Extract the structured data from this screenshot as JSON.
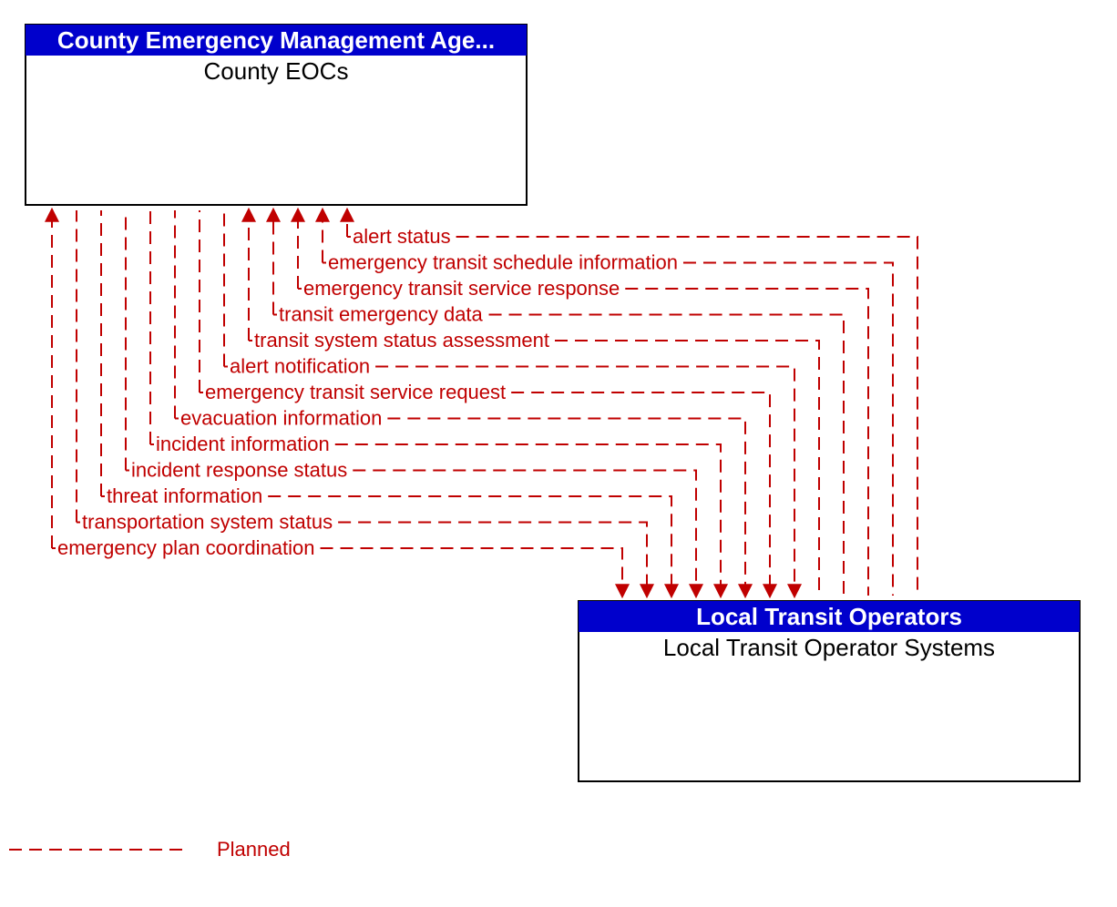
{
  "colors": {
    "header_bg": "#0000cc",
    "flow": "#c00000",
    "border": "#000000"
  },
  "boxes": {
    "county": {
      "header": "County Emergency Management Age...",
      "body": "County EOCs"
    },
    "transit": {
      "header": "Local Transit Operators",
      "body": "Local Transit Operator Systems"
    }
  },
  "flows": [
    {
      "label": "alert status",
      "dir": "to_county"
    },
    {
      "label": "emergency transit schedule information",
      "dir": "to_county"
    },
    {
      "label": "emergency transit service response",
      "dir": "to_county"
    },
    {
      "label": "transit emergency data",
      "dir": "to_county"
    },
    {
      "label": "transit system status assessment",
      "dir": "to_county"
    },
    {
      "label": "alert notification",
      "dir": "to_transit"
    },
    {
      "label": "emergency transit service request",
      "dir": "to_transit"
    },
    {
      "label": "evacuation information",
      "dir": "to_transit"
    },
    {
      "label": "incident information",
      "dir": "to_transit"
    },
    {
      "label": "incident response status",
      "dir": "to_transit"
    },
    {
      "label": "threat information",
      "dir": "to_transit"
    },
    {
      "label": "transportation system status",
      "dir": "to_transit"
    },
    {
      "label": "emergency plan coordination",
      "dir": "bidirectional"
    }
  ],
  "legend": {
    "planned": "Planned"
  }
}
